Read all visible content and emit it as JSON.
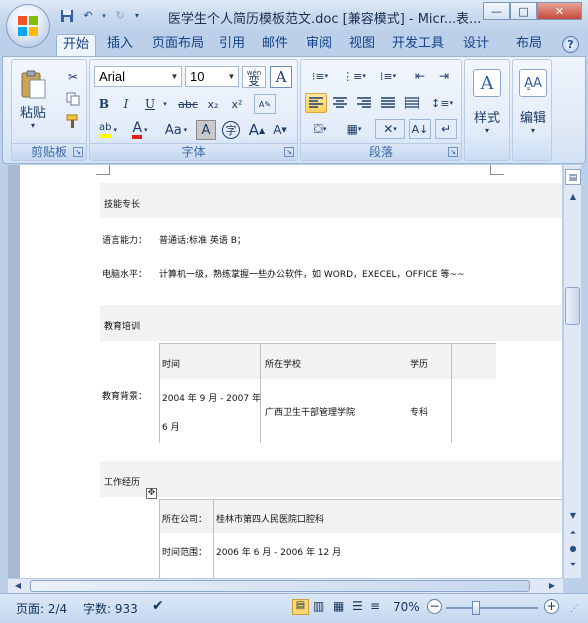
{
  "titlebar": {
    "title": "医学生个人简历模板范文.doc [兼容模式] - Micr...",
    "extra": "表...",
    "minimize": "—",
    "maximize": "□",
    "close": "✕"
  },
  "tabs": [
    "开始",
    "插入",
    "页面布局",
    "引用",
    "邮件",
    "审阅",
    "视图",
    "开发工具",
    "设计",
    "布局"
  ],
  "ribbon": {
    "clipboard": {
      "label": "剪贴板",
      "paste": "粘贴"
    },
    "font": {
      "label": "字体",
      "font_name": "Arial",
      "font_size": "10",
      "wen": "wén\n变",
      "bold": "B",
      "italic": "I",
      "underline": "U",
      "strike": "abc",
      "sub": "x₂",
      "sup": "x²",
      "highlight": "ab",
      "fontcolor": "A",
      "case": "Aa",
      "grow": "A",
      "shrink": "A",
      "char_border": "A",
      "enclose": "字"
    },
    "paragraph": {
      "label": "段落"
    },
    "styles": {
      "label": "样式"
    },
    "editing": {
      "label": "编辑"
    }
  },
  "document": {
    "skills_header": "技能专长",
    "lang_label": "语言能力：",
    "lang_value": "普通话:标准     英语 B；",
    "computer_label": "电脑水平：",
    "computer_value": "计算机一级，熟练掌握一些办公软件，如 WORD，EXECEL，OFFICE 等~~",
    "edu_header": "教育培训",
    "edu_bg_label": "教育背景：",
    "edu_col_time": "时间",
    "edu_col_school": "所在学校",
    "edu_col_degree": "学历",
    "edu_time_1": "2004 年 9 月  - 2007 年",
    "edu_time_2": "6 月",
    "edu_school": "广西卫生干部管理学院",
    "edu_degree": "专科",
    "work_header": "工作经历",
    "company_label": "所在公司：",
    "company_value": "桂林市第四人民医院口腔科",
    "period_label": "时间范围：",
    "period_value": "2006 年 6 月  - 2006 年 12 月"
  },
  "status": {
    "page": "页面: 2/4",
    "words": "字数: 933",
    "zoom": "70%"
  },
  "colors": {
    "accent": "#15428b",
    "shade": "#f2f2f2"
  }
}
